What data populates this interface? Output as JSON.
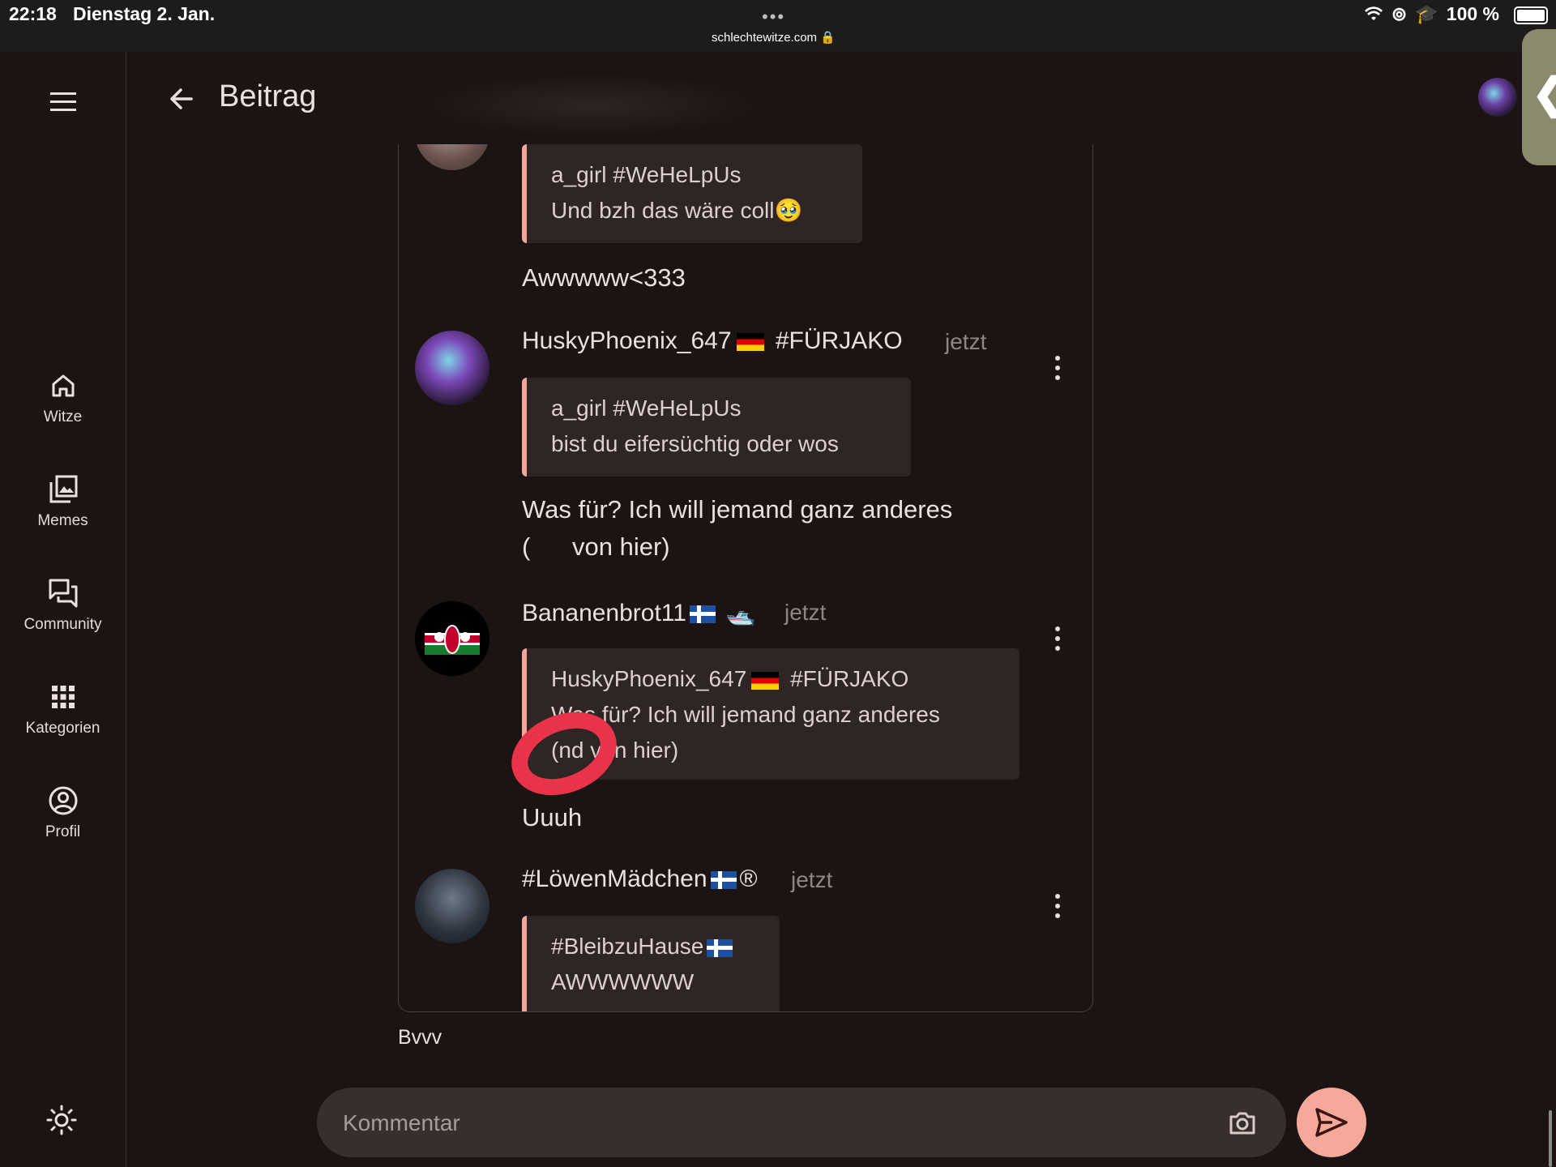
{
  "status_bar": {
    "time": "22:18",
    "date": "Dienstag 2. Jan.",
    "url": "schlechtewitze.com",
    "battery": "100 %",
    "dots": "•••"
  },
  "header": {
    "title": "Beitrag"
  },
  "nav": [
    {
      "label": "Witze",
      "icon": "home-icon"
    },
    {
      "label": "Memes",
      "icon": "image-library-icon"
    },
    {
      "label": "Community",
      "icon": "forum-icon"
    },
    {
      "label": "Kategorien",
      "icon": "apps-grid-icon"
    },
    {
      "label": "Profil",
      "icon": "account-circle-icon"
    }
  ],
  "comments": [
    {
      "quote_author": "a_girl #WeHeLpUs",
      "quote_text": "Und bzh das wäre coll🥹",
      "message": "Awwwww<333"
    },
    {
      "author": "HuskyPhoenix_647",
      "author_tag": "#FÜRJAKO",
      "time": "jetzt",
      "quote_author": "a_girl #WeHeLpUs",
      "quote_text": "bist du eifersüchtig oder wos",
      "message_line1": "Was für? Ich will jemand ganz anderes",
      "message_line2": "(      von hier)"
    },
    {
      "author": "Bananenbrot11",
      "time": "jetzt",
      "quote_author": "HuskyPhoenix_647",
      "quote_author_tag": "#FÜRJAKO",
      "quote_line1": "Was für? Ich will jemand ganz anderes",
      "quote_line2": "(nd von hier)",
      "message": "Uuuh"
    },
    {
      "author": "#LöwenMädchen",
      "author_suffix": "®",
      "time": "jetzt",
      "quote_author": "#BleibzuHause",
      "quote_text": "AWWWWWW"
    }
  ],
  "below_card_text": "Bvvv",
  "composer": {
    "placeholder": "Kommentar"
  },
  "colors": {
    "background": "#1b1413",
    "accent": "#f6a99a",
    "quote_bar": "#f0a899",
    "annotation": "#e8334a"
  }
}
